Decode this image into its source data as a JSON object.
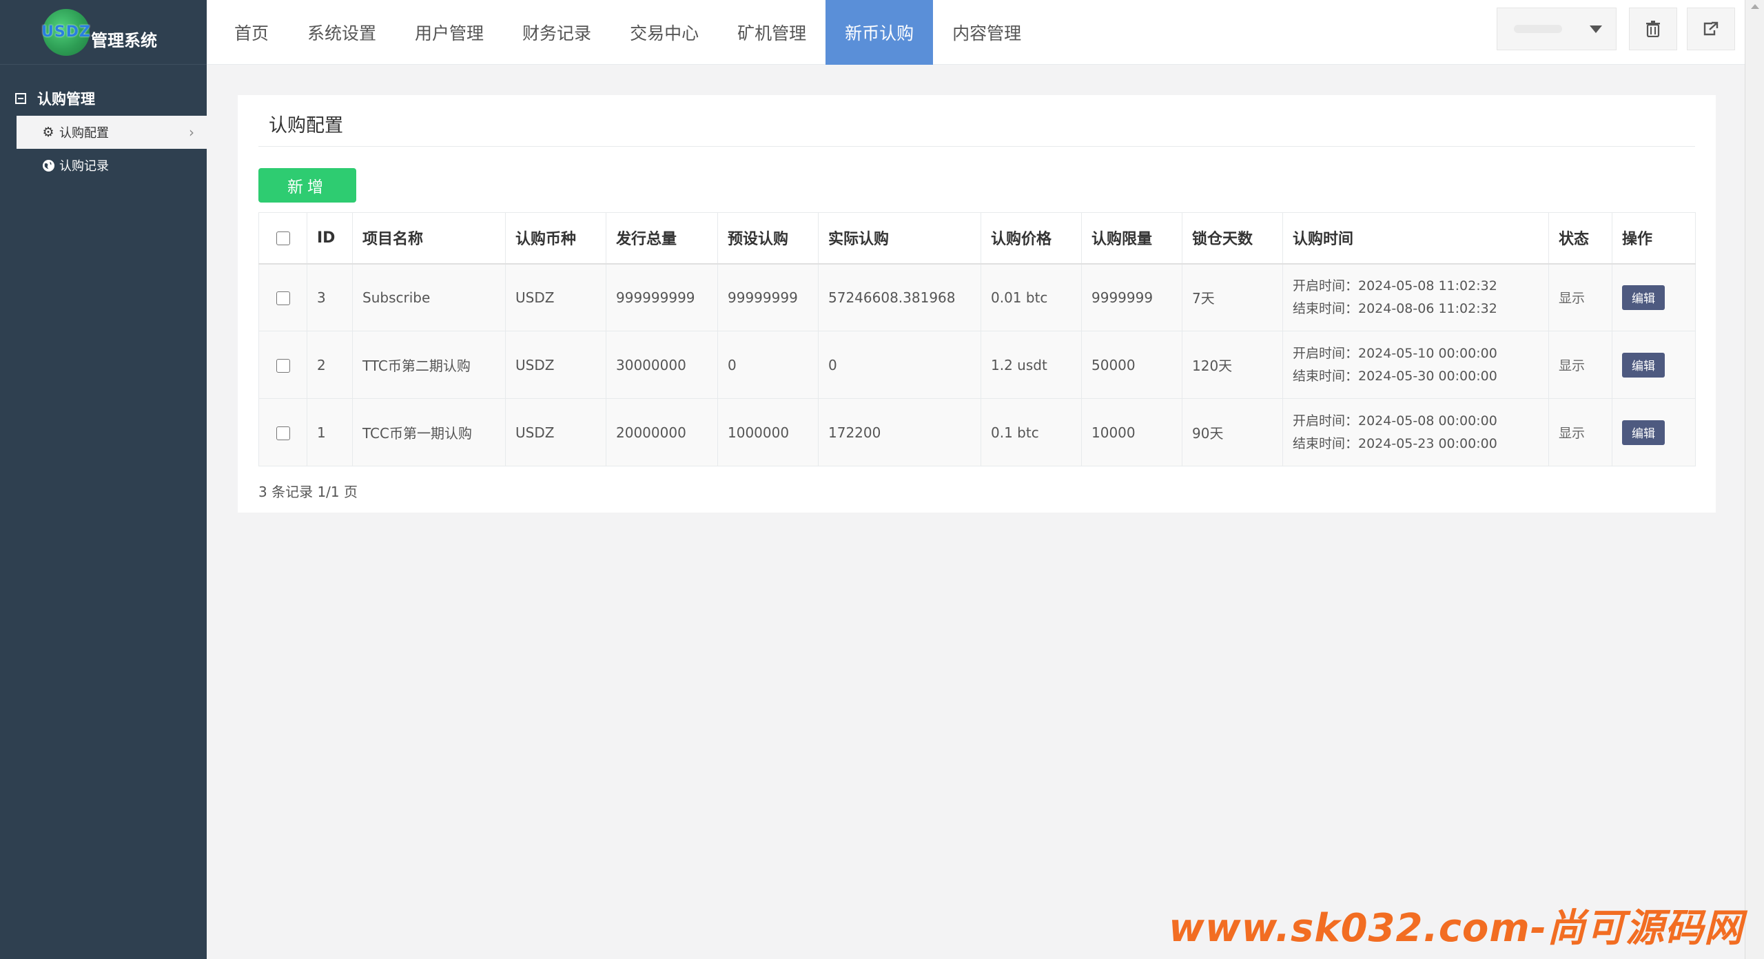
{
  "app": {
    "logo_text": "USDZ",
    "title": "管理系统"
  },
  "topnav": {
    "items": [
      "首页",
      "系统设置",
      "用户管理",
      "财务记录",
      "交易中心",
      "矿机管理",
      "新币认购",
      "内容管理"
    ],
    "active": "新币认购"
  },
  "sidebar": {
    "section": "认购管理",
    "items": [
      {
        "label": "认购配置",
        "icon": "gear-icon",
        "active": true
      },
      {
        "label": "认购记录",
        "icon": "globe-icon",
        "active": false
      }
    ]
  },
  "panel": {
    "title": "认购配置",
    "add_button": "新增"
  },
  "table": {
    "headers": [
      "ID",
      "项目名称",
      "认购币种",
      "发行总量",
      "预设认购",
      "实际认购",
      "认购价格",
      "认购限量",
      "锁仓天数",
      "认购时间",
      "状态",
      "操作"
    ],
    "rows": [
      {
        "id": "3",
        "name": "Subscribe",
        "coin": "USDZ",
        "total": "999999999",
        "preset": "99999999",
        "actual": "57246608.381968",
        "price": "0.01 btc",
        "limit": "9999999",
        "lock": "7天",
        "start": "开启时间：2024-05-08 11:02:32",
        "end": "结束时间：2024-08-06 11:02:32",
        "status": "显示",
        "action": "编辑"
      },
      {
        "id": "2",
        "name": "TTC币第二期认购",
        "coin": "USDZ",
        "total": "30000000",
        "preset": "0",
        "actual": "0",
        "price": "1.2 usdt",
        "limit": "50000",
        "lock": "120天",
        "start": "开启时间：2024-05-10 00:00:00",
        "end": "结束时间：2024-05-30 00:00:00",
        "status": "显示",
        "action": "编辑"
      },
      {
        "id": "1",
        "name": "TCC币第一期认购",
        "coin": "USDZ",
        "total": "20000000",
        "preset": "1000000",
        "actual": "172200",
        "price": "0.1 btc",
        "limit": "10000",
        "lock": "90天",
        "start": "开启时间：2024-05-08 00:00:00",
        "end": "结束时间：2024-05-23 00:00:00",
        "status": "显示",
        "action": "编辑"
      }
    ]
  },
  "pager": "3 条记录 1/1 页",
  "watermark": "www.sk032.com-尚可源码网",
  "colors": {
    "sidebar_bg": "#2f4050",
    "nav_active": "#5a8fd8",
    "add_button": "#2ecc71",
    "edit_button": "#4e5a80",
    "watermark": "#f26d22"
  }
}
